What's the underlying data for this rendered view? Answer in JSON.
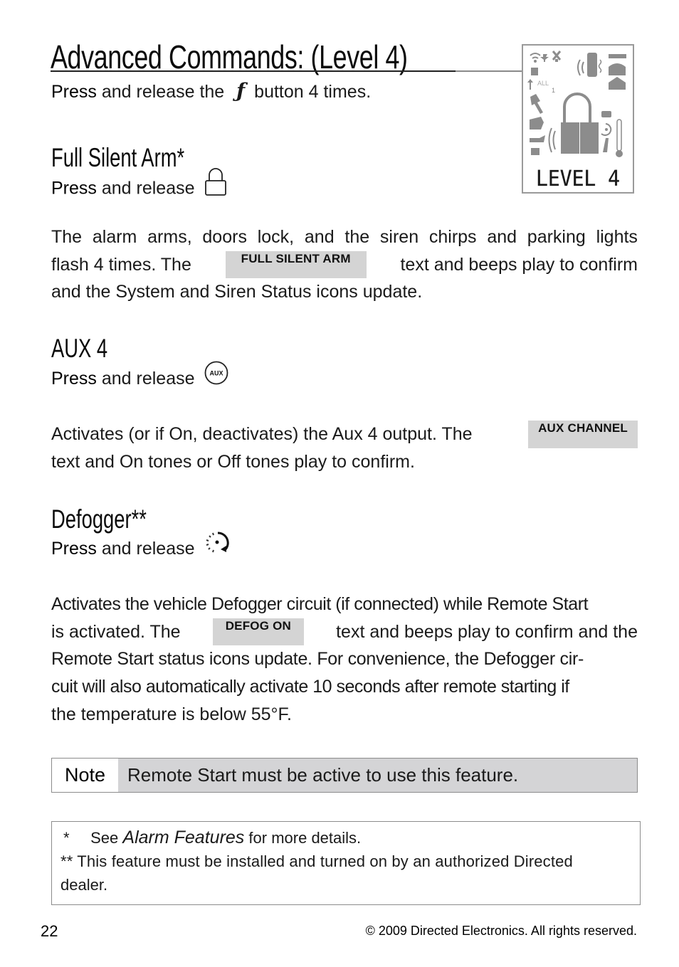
{
  "page": {
    "title": "Advanced Commands: (Level 4)",
    "intro": {
      "press": "Press",
      "before_icon": "and release the",
      "icon": "f-function-icon",
      "icon_glyph": "ƒ",
      "after_icon": "button 4 times."
    },
    "lcd": {
      "icon": "lcd-display-icon",
      "text": "LEVEL 4",
      "all_label": "ALL",
      "one_label": "1"
    },
    "sections": [
      {
        "heading": "Full Silent Arm*",
        "press": "Press",
        "action": "and release",
        "button_icon": "lock-icon",
        "paragraph_rows": [
          [
            "The",
            "alarm",
            "arms,",
            "doors",
            "lock,",
            "and",
            "the",
            "siren",
            "chirps",
            "and",
            "parking",
            "lights"
          ],
          [
            "flash 4 times. The",
            "FULL SILENT ARM",
            "text and beeps play to confirm"
          ],
          [
            "and the System and Siren Status icons update."
          ]
        ],
        "tag": "FULL SILENT ARM"
      },
      {
        "heading": "AUX 4",
        "press": "Press",
        "action": "and release",
        "button_icon": "aux-button-icon",
        "button_label": "AUX",
        "paragraph_rows": [
          [
            "Activates (or if On, deactivates) the Aux 4 output. The",
            "AUX CHANNEL"
          ],
          [
            "text and On tones or Off tones play to confirm."
          ]
        ],
        "tag": "AUX CHANNEL"
      },
      {
        "heading": "Defogger**",
        "press": "Press",
        "action": "and release",
        "button_icon": "defog-timer-icon",
        "paragraph_rows": [
          [
            "Activates the vehicle Defogger circuit (if connected) while Remote Start"
          ],
          [
            "is activated. The",
            "DEFOG ON",
            "text and beeps play to confirm and the"
          ],
          [
            "Remote Start status icons update. For convenience, the Defogger cir-"
          ],
          [
            "cuit will also automatically activate 10 seconds after remote starting if"
          ],
          [
            "the temperature is below 55°F."
          ]
        ],
        "tag": "DEFOG ON"
      }
    ],
    "note": {
      "label": "Note",
      "text": "Remote Start must be active to use this feature."
    },
    "footnotes": {
      "line1_marker": "*",
      "line1_pre": "See",
      "line1_italic": "Alarm Features",
      "line1_post": "for more details.",
      "line2": "** This feature must be installed and turned on by an authorized Directed",
      "line3": "dealer."
    },
    "footer": {
      "page_number": "22",
      "copyright": "© 2009 Directed Electronics. All rights reserved."
    }
  }
}
